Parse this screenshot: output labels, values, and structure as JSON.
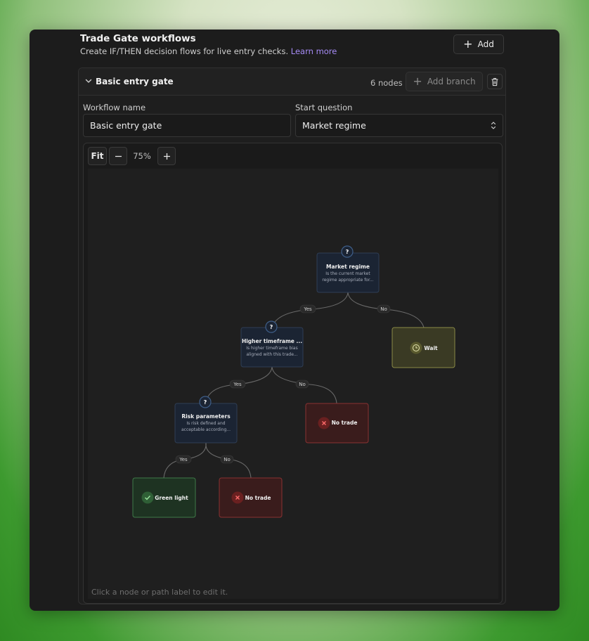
{
  "header": {
    "title": "Trade Gate workflows",
    "subtitle": "Create IF/THEN decision flows for live entry checks.",
    "learn_more": "Learn more",
    "add_label": "Add"
  },
  "workflow": {
    "name": "Basic entry gate",
    "node_count": "6 nodes",
    "add_branch_label": "Add branch"
  },
  "form": {
    "name_label": "Workflow name",
    "name_value": "Basic entry gate",
    "start_label": "Start question",
    "start_value": "Market regime"
  },
  "canvas": {
    "fit_label": "Fit",
    "zoom": "75%",
    "hint": "Click a node or path label to edit it."
  },
  "nodes": {
    "market_regime": {
      "title": "Market regime",
      "desc1": "Is the current market",
      "desc2": "regime appropriate for..."
    },
    "higher_tf": {
      "title": "Higher timeframe ...",
      "desc1": "Is higher timeframe bias",
      "desc2": "aligned with this trade..."
    },
    "risk": {
      "title": "Risk parameters",
      "desc1": "Is risk defined and",
      "desc2": "acceptable according..."
    },
    "wait": {
      "title": "Wait"
    },
    "no_trade_1": {
      "title": "No trade"
    },
    "green_light": {
      "title": "Green light"
    },
    "no_trade_2": {
      "title": "No trade"
    }
  },
  "edges": {
    "yes": "Yes",
    "no": "No",
    "question_mark": "?"
  },
  "icons": [
    "chevron-down-icon",
    "plus-icon",
    "trash-icon",
    "select-arrows-icon",
    "minus-icon",
    "question-icon",
    "clock-icon",
    "x-icon",
    "check-icon"
  ],
  "colors": {
    "accent_link": "#a68bf5",
    "question_node": "#1b2433",
    "wait_node": "#3a3a24",
    "no_trade_node": "#3a1c1c",
    "green_light_node": "#1e3322"
  }
}
